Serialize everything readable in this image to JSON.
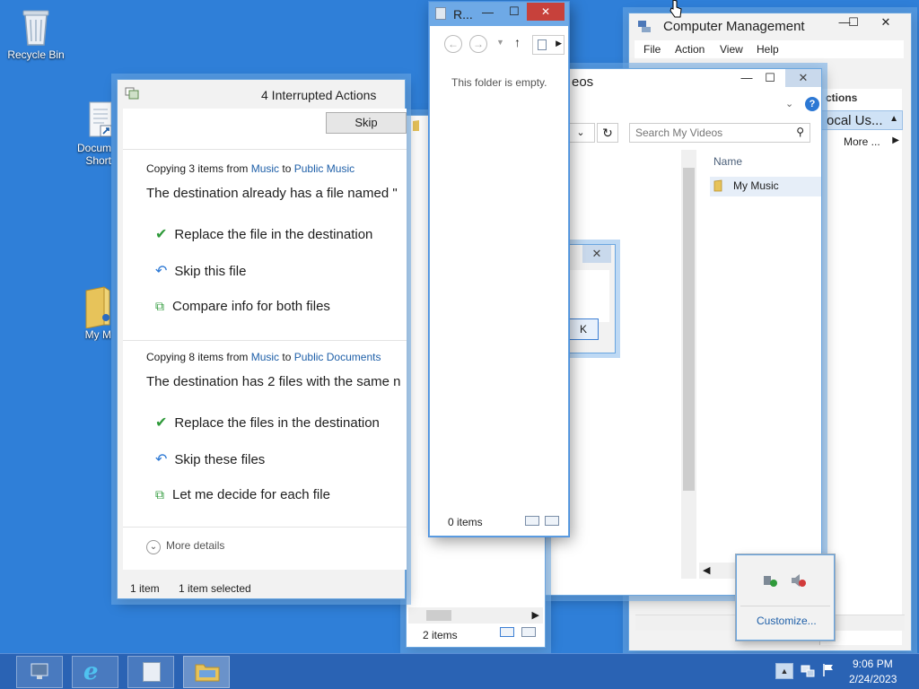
{
  "desktop": {
    "icons": [
      {
        "label": "Recycle Bin"
      },
      {
        "label": "Docum\nShort"
      },
      {
        "label": "My M"
      }
    ]
  },
  "computer_management": {
    "title": "Computer Management",
    "menu": [
      "File",
      "Action",
      "View",
      "Help"
    ],
    "actions_header": "ctions",
    "item_selected": "ocal Us...",
    "more": "More ..."
  },
  "videos_window": {
    "title": "eos",
    "search_placeholder": "Search My Videos",
    "column_name": "Name",
    "items": [
      {
        "label": "My Music"
      }
    ]
  },
  "r_window": {
    "title": "R...",
    "empty_text": "This folder is empty.",
    "status": "0 items"
  },
  "interrupted": {
    "title": "4 Interrupted Actions",
    "skip_label": "Skip",
    "section1": {
      "from_prefix": "Copying 3 items from ",
      "source": "Music",
      "to_word": " to ",
      "dest": "Public Music",
      "headline": "The destination already has a file named \"",
      "options": [
        "Replace the file in the destination",
        "Skip this file",
        "Compare info for both files"
      ]
    },
    "section2": {
      "from_prefix": "Copying 8 items from ",
      "source": "Music",
      "to_word": " to ",
      "dest": "Public Documents",
      "headline": "The destination has 2 files with the same n",
      "options": [
        "Replace the files in the destination",
        "Skip these files",
        "Let me decide for each file"
      ]
    },
    "more_details": "More details",
    "status_items": "1 item",
    "status_selected": "1 item selected"
  },
  "explorer_behind": {
    "status": "2 items"
  },
  "small_dialog": {
    "ok_fragment": "K"
  },
  "tray_popup": {
    "customize": "Customize..."
  },
  "clock": {
    "time": "9:06 PM",
    "date": "2/24/2023"
  },
  "colors": {
    "desktop": "#2f7fd8",
    "taskbar": "#2a63b4",
    "close_red": "#c7413b",
    "link": "#1e5fa8",
    "check_green": "#2f9a3a"
  }
}
